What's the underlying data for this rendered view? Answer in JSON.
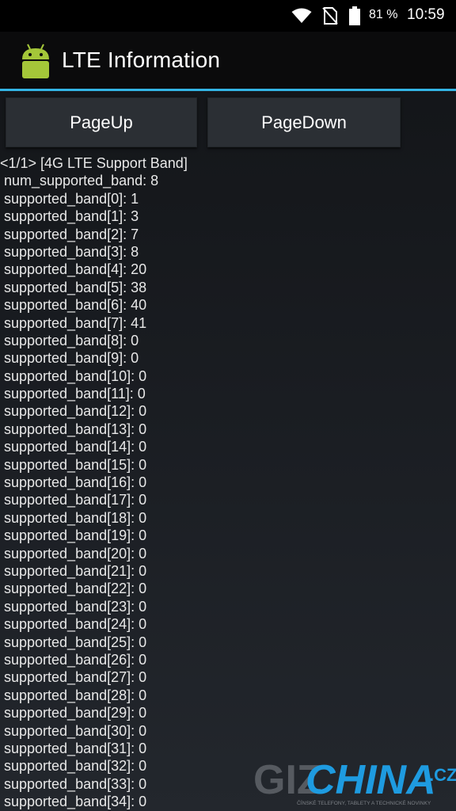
{
  "status_bar": {
    "battery_text": "81 %",
    "clock": "10:59",
    "icons": [
      "wifi-icon",
      "no-sim-icon",
      "battery-icon"
    ]
  },
  "action_bar": {
    "title": "LTE Information",
    "icon": "android-icon"
  },
  "buttons": {
    "page_up": "PageUp",
    "page_down": "PageDown"
  },
  "info": {
    "header": "<1/1> [4G LTE Support Band]",
    "lines": [
      "num_supported_band: 8",
      "supported_band[0]: 1",
      "supported_band[1]: 3",
      "supported_band[2]: 7",
      "supported_band[3]: 8",
      "supported_band[4]: 20",
      "supported_band[5]: 38",
      "supported_band[6]: 40",
      "supported_band[7]: 41",
      "supported_band[8]: 0",
      "supported_band[9]: 0",
      "supported_band[10]: 0",
      "supported_band[11]: 0",
      "supported_band[12]: 0",
      "supported_band[13]: 0",
      "supported_band[14]: 0",
      "supported_band[15]: 0",
      "supported_band[16]: 0",
      "supported_band[17]: 0",
      "supported_band[18]: 0",
      "supported_band[19]: 0",
      "supported_band[20]: 0",
      "supported_band[21]: 0",
      "supported_band[22]: 0",
      "supported_band[23]: 0",
      "supported_band[24]: 0",
      "supported_band[25]: 0",
      "supported_band[26]: 0",
      "supported_band[27]: 0",
      "supported_band[28]: 0",
      "supported_band[29]: 0",
      "supported_band[30]: 0",
      "supported_band[31]: 0",
      "supported_band[32]: 0",
      "supported_band[33]: 0",
      "supported_band[34]: 0"
    ]
  },
  "watermark": {
    "brand_left": "GIZ",
    "brand_right": "CHINA",
    "tld": ".CZ",
    "tagline": "ČÍNSKÉ TELEFONY, TABLETY A TECHNICKÉ NOVINKY"
  },
  "colors": {
    "accent": "#33b5e5",
    "android_green": "#a4c639",
    "watermark_blue": "#1e9be0"
  }
}
